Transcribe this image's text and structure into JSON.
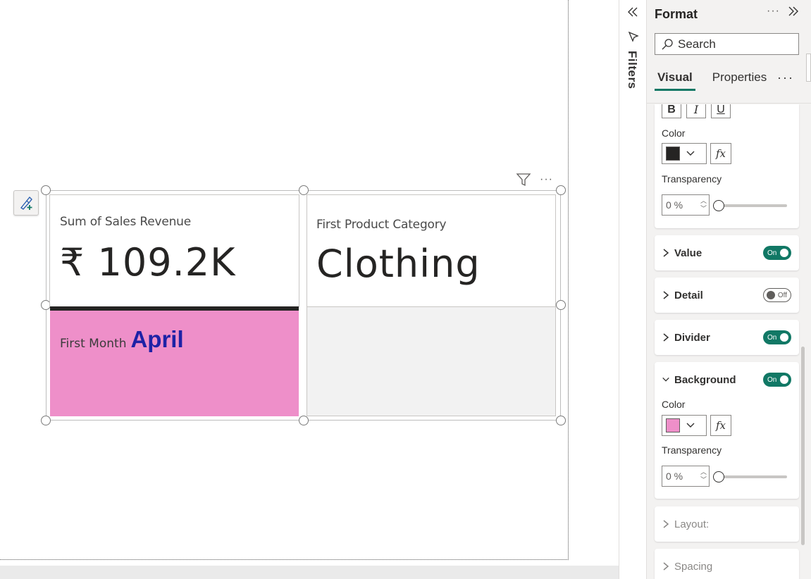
{
  "canvas": {
    "cards": {
      "sales": {
        "label": "Sum of Sales Revenue",
        "value": "₹ 109.2K"
      },
      "category": {
        "label": "First Product Category",
        "value": "Clothing"
      },
      "month": {
        "label": "First Month",
        "value": "April"
      }
    },
    "colors": {
      "detail_bg": "#ee8fc9",
      "month_value": "#1e22a6",
      "divider": "#252423",
      "empty_cell": "#f2f2f2"
    },
    "icons": {
      "format_brush": "format-painter-icon",
      "visual_filter": "filter-icon",
      "visual_more": "more-options-icon"
    }
  },
  "filters": {
    "label": "Filters",
    "icons": [
      "collapse-left-icon",
      "filter-icon"
    ]
  },
  "format_pane": {
    "title": "Format",
    "search": {
      "placeholder": "Search"
    },
    "tabs": {
      "visual": "Visual",
      "properties": "Properties",
      "more": "···"
    },
    "text_section": {
      "buttons": {
        "bold": "B",
        "italic": "I",
        "underline": "U"
      },
      "color_label": "Color",
      "color": "#252423",
      "fx": "fx",
      "transparency_label": "Transparency",
      "transparency_value": "0 %",
      "transparency": 0
    },
    "sections": {
      "value": {
        "label": "Value",
        "toggle": "On"
      },
      "detail": {
        "label": "Detail",
        "toggle": "Off"
      },
      "divider": {
        "label": "Divider",
        "toggle": "On"
      },
      "background": {
        "label": "Background",
        "toggle": "On",
        "color_label": "Color",
        "color": "#ee8fc9",
        "fx": "fx",
        "transparency_label": "Transparency",
        "transparency_value": "0 %",
        "transparency": 0
      },
      "layout": {
        "label": "Layout:"
      },
      "spacing": {
        "label": "Spacing"
      }
    },
    "accent": "#117865"
  }
}
